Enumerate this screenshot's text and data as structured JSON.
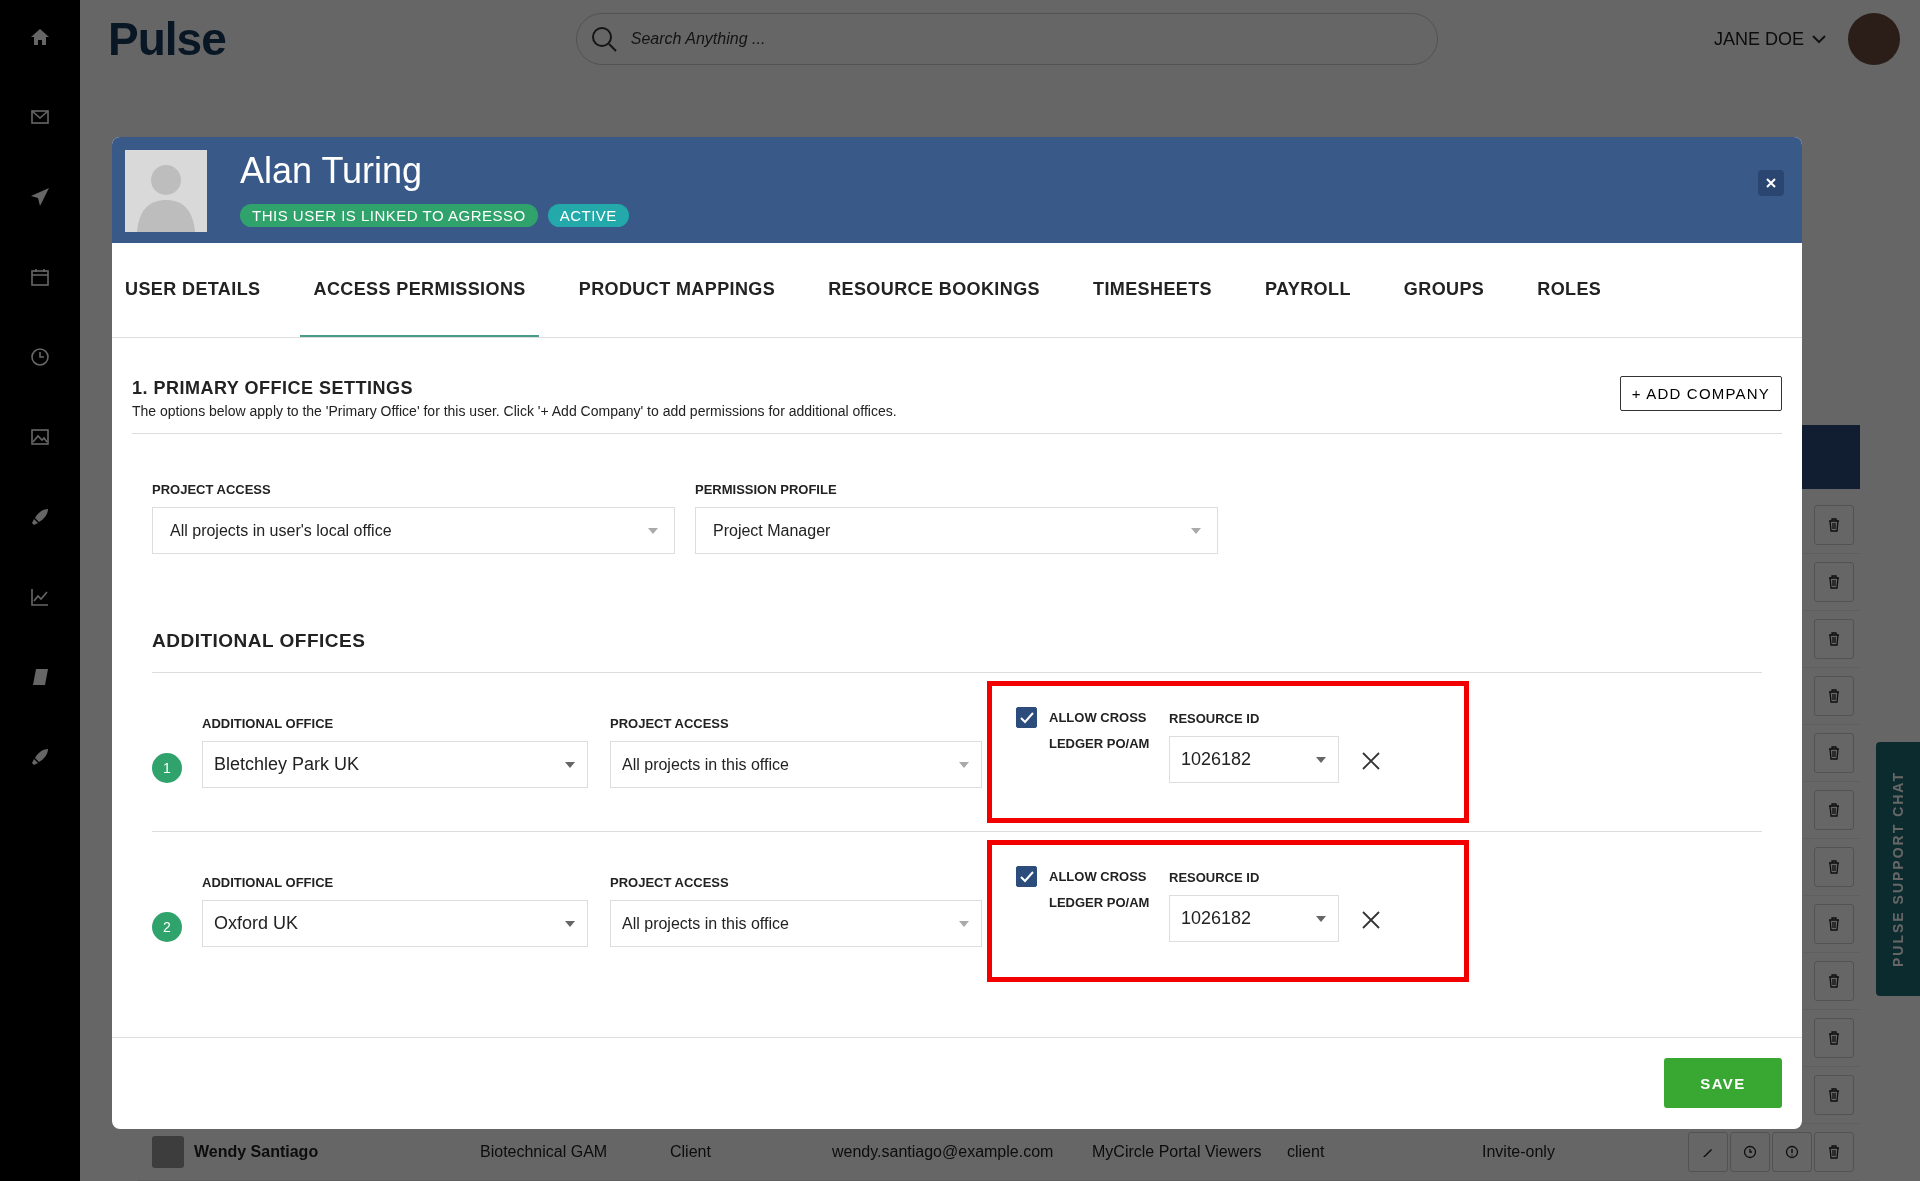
{
  "top_bar": {
    "logo": "Pulse",
    "search": {
      "placeholder": "Search Anything ..."
    },
    "user": {
      "name": "JANE DOE"
    }
  },
  "modal": {
    "title": "Alan Turing",
    "badges": [
      {
        "text": "THIS USER IS LINKED TO AGRESSO",
        "color": "#2fa36b"
      },
      {
        "text": "ACTIVE",
        "color": "#23a9a9"
      }
    ],
    "tabs": [
      {
        "label": "USER DETAILS",
        "selected": false
      },
      {
        "label": "ACCESS PERMISSIONS",
        "selected": true
      },
      {
        "label": "PRODUCT MAPPINGS",
        "selected": false
      },
      {
        "label": "RESOURCE BOOKINGS",
        "selected": false
      },
      {
        "label": "TIMESHEETS",
        "selected": false
      },
      {
        "label": "PAYROLL",
        "selected": false
      },
      {
        "label": "GROUPS",
        "selected": false
      },
      {
        "label": "ROLES",
        "selected": false
      }
    ],
    "primary": {
      "title": "1. PRIMARY OFFICE SETTINGS",
      "description": "The options below apply to the 'Primary Office' for this user. Click '+ Add Company' to add permissions for additional offices.",
      "add_button": "+ ADD COMPANY",
      "fields": [
        {
          "label": "PROJECT ACCESS",
          "value": "All projects in user's local office"
        },
        {
          "label": "PERMISSION PROFILE",
          "value": "Project Manager"
        }
      ]
    },
    "additional_offices": {
      "title": "ADDITIONAL OFFICES",
      "rows": [
        {
          "number": "1",
          "office_label": "ADDITIONAL OFFICE",
          "office": "Bletchley Park UK",
          "access_label": "PROJECT ACCESS",
          "access": "All projects in this office",
          "allow_cross_label": "ALLOW CROSS LEDGER PO/AM",
          "allow_cross": true,
          "resource_label": "RESOURCE ID",
          "resource_id": "1026182",
          "highlighted": true
        },
        {
          "number": "2",
          "office_label": "ADDITIONAL OFFICE",
          "office": "Oxford UK",
          "access_label": "PROJECT ACCESS",
          "access": "All projects in this office",
          "allow_cross_label": "ALLOW CROSS LEDGER PO/AM",
          "allow_cross": true,
          "resource_label": "RESOURCE ID",
          "resource_id": "1026182",
          "highlighted": true
        }
      ]
    },
    "save_button": "SAVE"
  },
  "background_row": {
    "name": "Wendy Santiago",
    "cells": [
      "Biotechnical GAM",
      "Client",
      "wendy.santiago@example.com",
      "MyCircle Portal Viewers",
      "client",
      "Invite-only"
    ]
  },
  "chat_tab": {
    "label": "PULSE SUPPORT CHAT"
  }
}
